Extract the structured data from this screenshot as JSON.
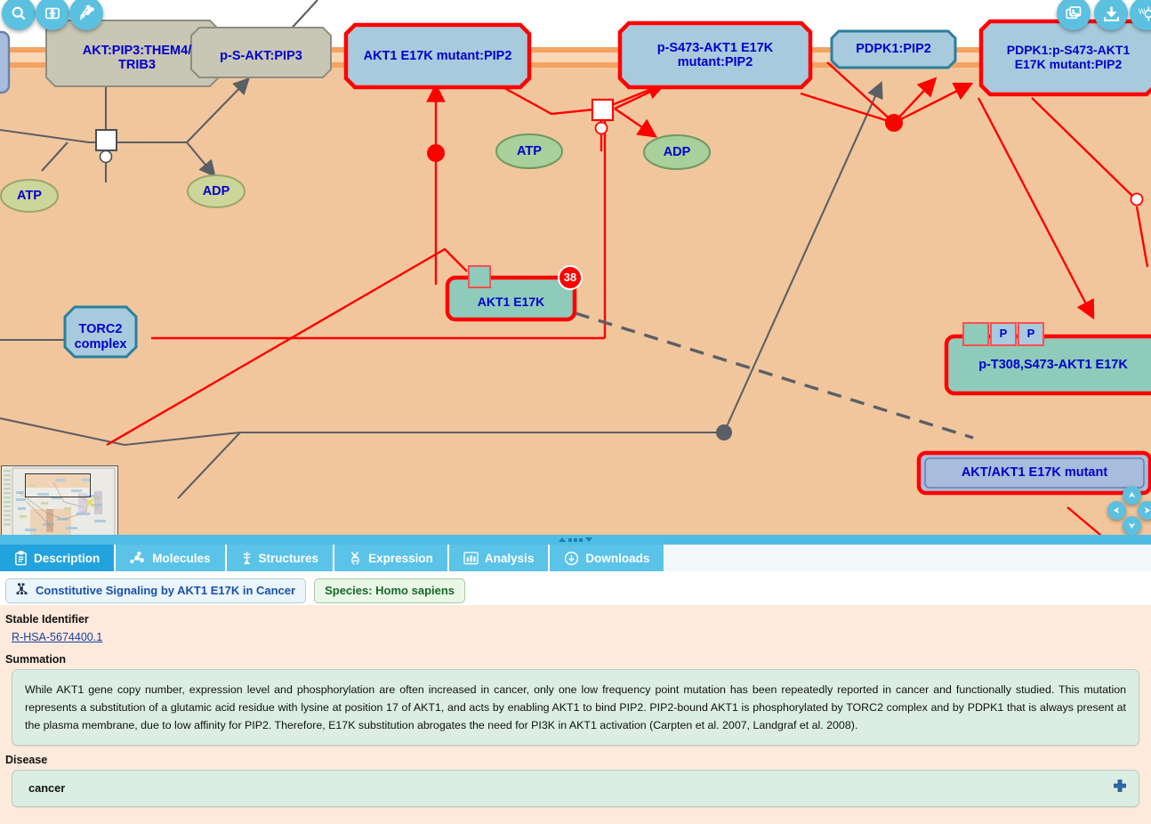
{
  "diagram": {
    "name": "pathway-diagram",
    "toolbar_left": [
      {
        "name": "search-icon",
        "title": "Search"
      },
      {
        "name": "fit-to-screen-icon",
        "title": "Fit to screen"
      },
      {
        "name": "pathway-overview-icon",
        "title": "Pathway overview"
      }
    ],
    "toolbar_right": [
      {
        "name": "snapshot-icon",
        "title": "Snapshot"
      },
      {
        "name": "download-icon",
        "title": "Download"
      },
      {
        "name": "word-export-icon",
        "title": "Export"
      }
    ],
    "navigation": {
      "up": "▲",
      "down": "▼",
      "left": "◀",
      "right": "▶"
    },
    "nodes": [
      {
        "id": "akt-pip3-them4-trib3",
        "label": "AKT:PIP3:THEM4/\nTRIB3",
        "style": "complex-grey"
      },
      {
        "id": "p-s-akt-pip3",
        "label": "p-S-AKT:PIP3",
        "style": "complex-grey"
      },
      {
        "id": "akt1-e17k-mutant-pip2",
        "label": "AKT1 E17K mutant:PIP2",
        "style": "complex-blue-highlight"
      },
      {
        "id": "p-s473-akt1-e17k-mutant-pip2",
        "label": "p-S473-AKT1 E17K\nmutant:PIP2",
        "style": "complex-blue-highlight"
      },
      {
        "id": "pdpk1-pip2",
        "label": "PDPK1:PIP2",
        "style": "complex-blue"
      },
      {
        "id": "pdpk1-p-s473-akt1-e17k-mutant-pip2",
        "label": "PDPK1:p-S473-AKT1\nE17K mutant:PIP2",
        "style": "complex-blue-highlight"
      },
      {
        "id": "atp-left",
        "label": "ATP",
        "style": "small-molecule"
      },
      {
        "id": "adp-left",
        "label": "ADP",
        "style": "small-molecule"
      },
      {
        "id": "atp-mid",
        "label": "ATP",
        "style": "small-molecule"
      },
      {
        "id": "adp-mid",
        "label": "ADP",
        "style": "small-molecule"
      },
      {
        "id": "akt1-e17k",
        "label": "AKT1 E17K",
        "style": "protein-highlight",
        "badge": "38"
      },
      {
        "id": "torc2-complex",
        "label": "TORC2\ncomplex",
        "style": "complex-blue"
      },
      {
        "id": "p-t308-s473-akt1-e17k",
        "label": "p-T308,S473-AKT1 E17K",
        "style": "protein-highlight",
        "modifications": [
          "",
          "P",
          "P"
        ]
      },
      {
        "id": "akt-akt1-e17k-mutant",
        "label": "AKT/AKT1 E17K mutant",
        "style": "set-highlight"
      }
    ],
    "colors": {
      "cytosol": "#f2c69c",
      "membrane": "#f4a261",
      "highlight": "#ff0000",
      "complex_fill": "#a8cadd",
      "protein_fill": "#8ecbba",
      "small_molecule_fill": "#cdd69a",
      "node_text": "#0000cc"
    }
  },
  "splitter": {
    "name": "panel-splitter"
  },
  "tabs": [
    {
      "id": "description",
      "label": "Description",
      "icon": "clipboard-icon",
      "active": true
    },
    {
      "id": "molecules",
      "label": "Molecules",
      "icon": "molecules-icon",
      "active": false
    },
    {
      "id": "structures",
      "label": "Structures",
      "icon": "structures-icon",
      "active": false
    },
    {
      "id": "expression",
      "label": "Expression",
      "icon": "dna-icon",
      "active": false
    },
    {
      "id": "analysis",
      "label": "Analysis",
      "icon": "bar-chart-icon",
      "active": false
    },
    {
      "id": "downloads",
      "label": "Downloads",
      "icon": "download-cloud-icon",
      "active": false
    }
  ],
  "detail": {
    "breadcrumb": {
      "icon": "pathway-node-icon",
      "title": "Constitutive Signaling by AKT1 E17K in Cancer"
    },
    "species": "Species: Homo sapiens",
    "stable_identifier": {
      "label": "Stable Identifier",
      "value": "R-HSA-5674400.1"
    },
    "summation": {
      "label": "Summation",
      "text": "While AKT1 gene copy number, expression level and phosphorylation are often increased in cancer, only one low frequency point mutation has been repeatedly reported in cancer and functionally studied. This mutation represents a substitution of a glutamic acid residue with lysine at position 17 of AKT1, and acts by enabling AKT1 to bind PIP2. PIP2-bound AKT1 is phosphorylated by TORC2 complex and by PDPK1 that is always present at the plasma membrane, due to low affinity for PIP2. Therefore, E17K substitution abrogates the need for PI3K in AKT1 activation (Carpten et al. 2007, Landgraf et al. 2008)."
    },
    "disease": {
      "label": "Disease",
      "value": "cancer",
      "expand_icon": "plus-icon"
    }
  }
}
